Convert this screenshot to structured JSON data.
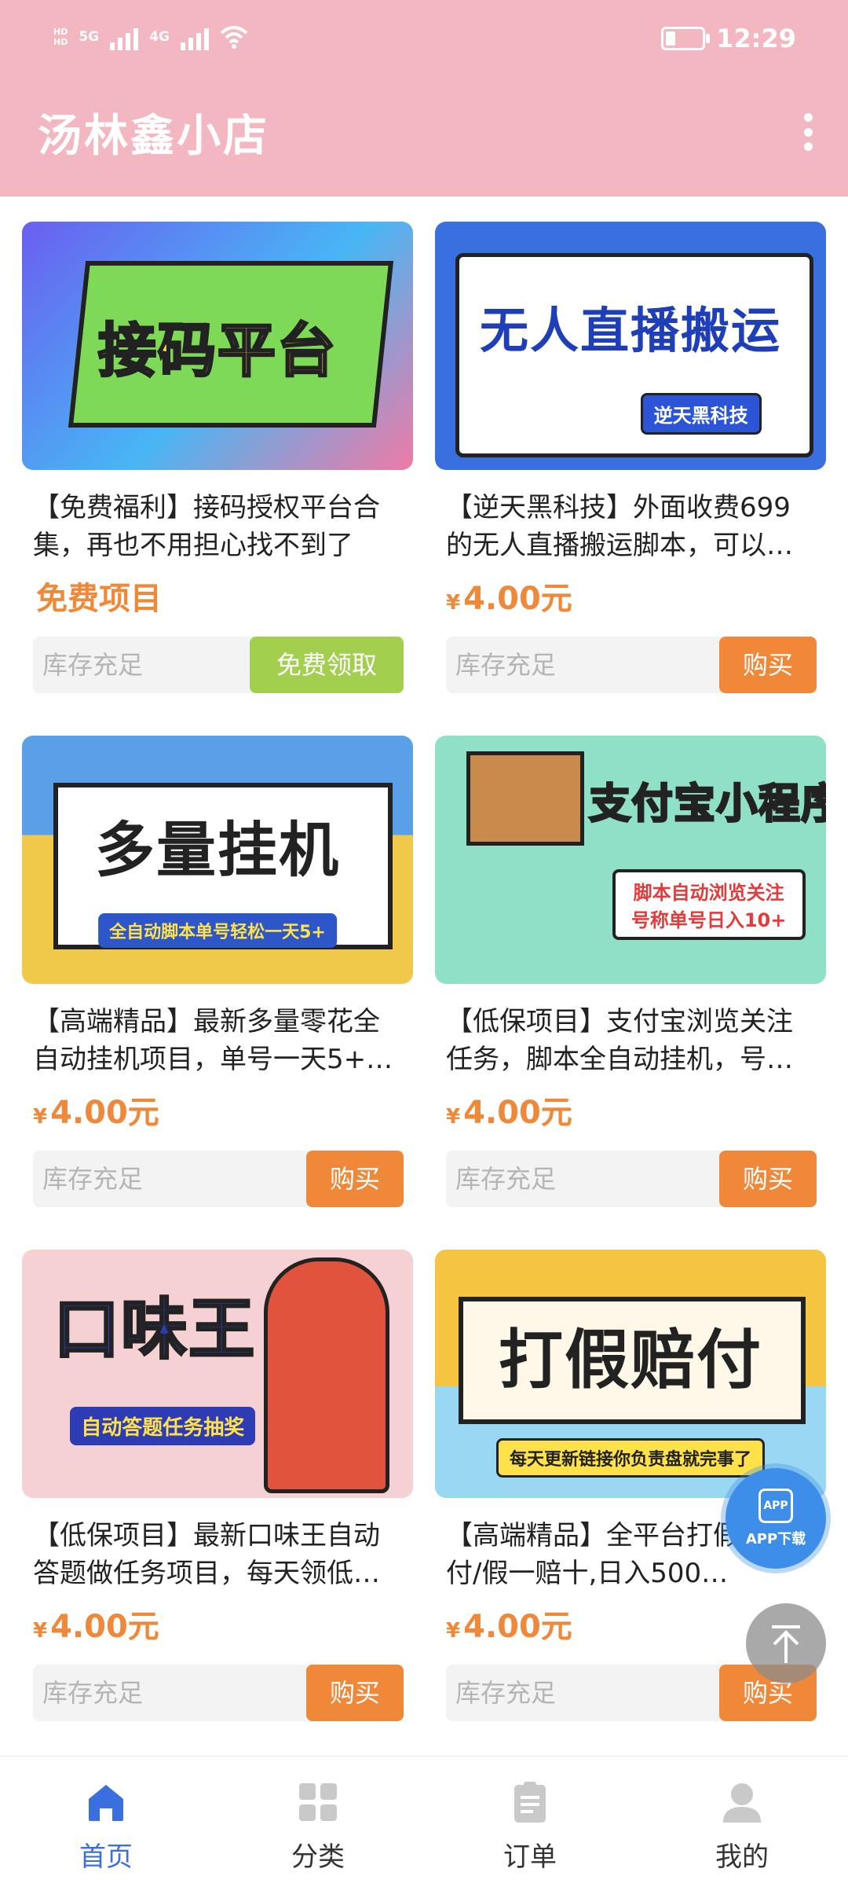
{
  "status_bar": {
    "time": "12:29",
    "net_1": "5G",
    "net_2": "4G",
    "hd_1": "HD",
    "hd_2": "HD"
  },
  "header": {
    "title": "汤林鑫小店"
  },
  "colors": {
    "header_bg": "#f3b7c1",
    "price": "#f0883a",
    "buy_button": "#f0883a",
    "free_button": "#a3cf4f",
    "nav_active": "#3a6fe0"
  },
  "products": [
    {
      "banner": "接码平台",
      "banner_sub": "",
      "desc": "【免费福利】接码授权平台合集，再也不用担心找不到了",
      "currency": "",
      "price": "免费项目",
      "stock": "库存充足",
      "button": "免费领取",
      "button_type": "free"
    },
    {
      "banner": "无人直播搬运",
      "banner_sub": "逆天黑科技",
      "desc": "【逆天黑科技】外面收费699的无人直播搬运脚本，可以…",
      "currency": "¥",
      "price": "4.00元",
      "stock": "库存充足",
      "button": "购买",
      "button_type": "buy"
    },
    {
      "banner": "多量挂机",
      "banner_sub": "全自动脚本单号轻松一天5+",
      "desc": "【高端精品】最新多量零花全自动挂机项目，单号一天5+…",
      "currency": "¥",
      "price": "4.00元",
      "stock": "库存充足",
      "button": "购买",
      "button_type": "buy"
    },
    {
      "banner": "支付宝小程序",
      "banner_sub": "脚本自动浏览关注 号称单号日入10+",
      "desc": "【低保项目】支付宝浏览关注任务，脚本全自动挂机，号…",
      "currency": "¥",
      "price": "4.00元",
      "stock": "库存充足",
      "button": "购买",
      "button_type": "buy"
    },
    {
      "banner": "口味王",
      "banner_sub": "自动答题任务抽奖",
      "desc": "【低保项目】最新口味王自动答题做任务项目，每天领低…",
      "currency": "¥",
      "price": "4.00元",
      "stock": "库存充足",
      "button": "购买",
      "button_type": "buy"
    },
    {
      "banner": "打假赔付",
      "banner_sub": "每天更新链接你负责盘就完事了",
      "desc": "【高端精品】全平台打假货/赔付/假一赔十,日入500…",
      "currency": "¥",
      "price": "4.00元",
      "stock": "库存充足",
      "button": "购买",
      "button_type": "buy"
    }
  ],
  "float_app": {
    "box": "APP",
    "label": "APP下载"
  },
  "bottom_nav": [
    {
      "label": "首页",
      "icon": "home-icon",
      "active": true
    },
    {
      "label": "分类",
      "icon": "grid-icon",
      "active": false
    },
    {
      "label": "订单",
      "icon": "clipboard-icon",
      "active": false
    },
    {
      "label": "我的",
      "icon": "user-icon",
      "active": false
    }
  ]
}
